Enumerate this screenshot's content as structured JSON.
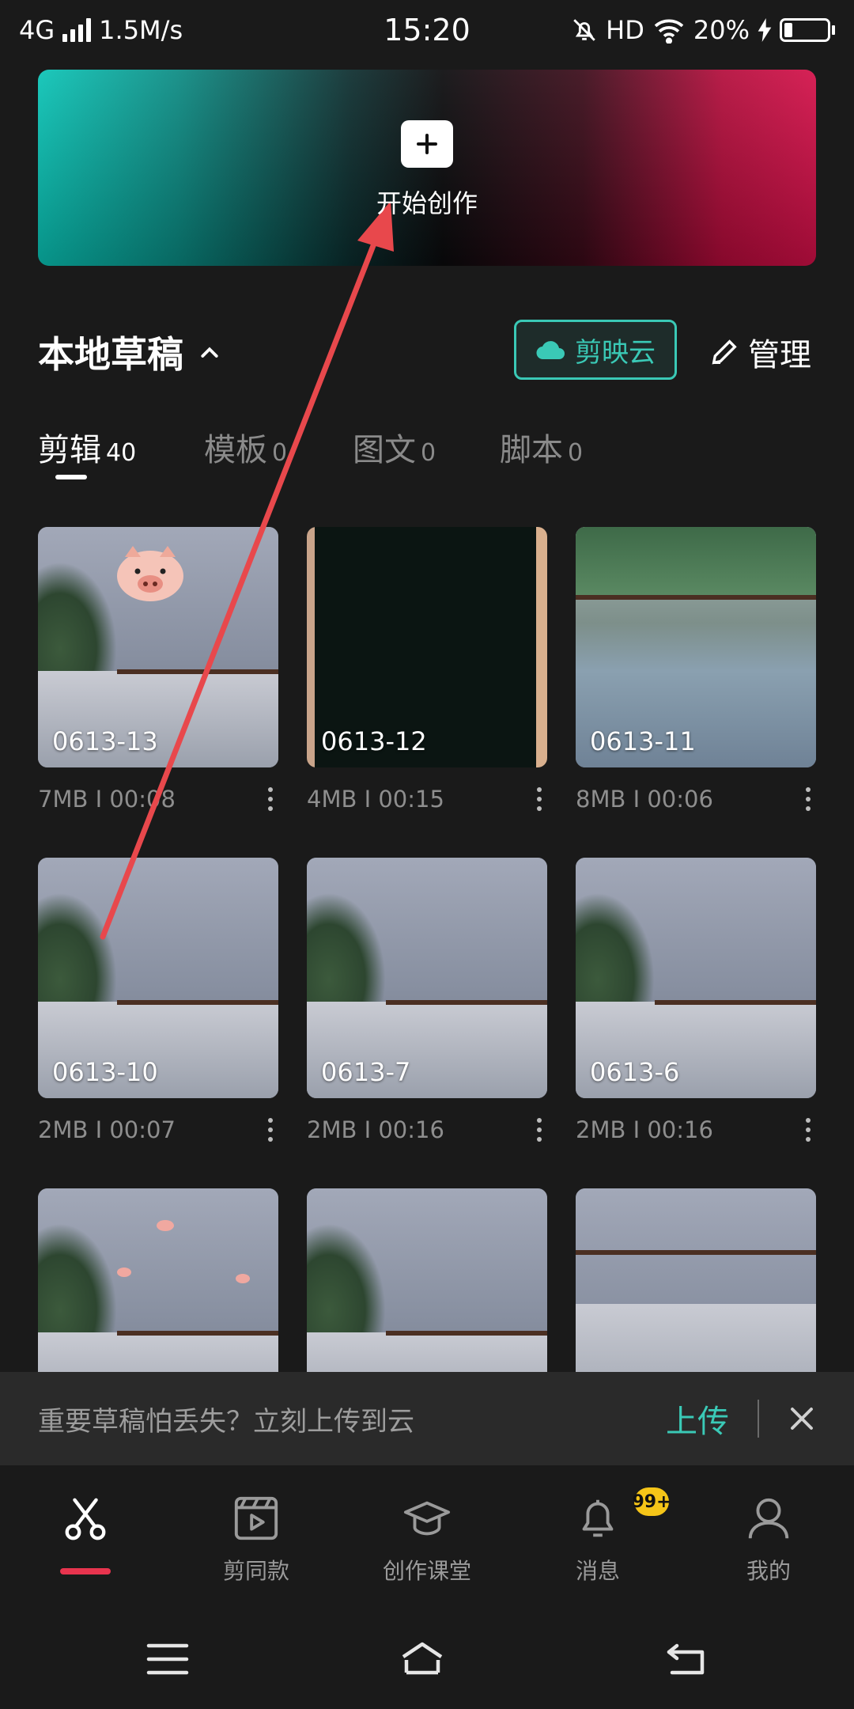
{
  "status_bar": {
    "network": "4G",
    "speed": "1.5M/s",
    "time": "15:20",
    "hd": "HD",
    "battery": "20%",
    "battery_level": 0.2
  },
  "hero": {
    "label": "开始创作"
  },
  "drafts": {
    "title": "本地草稿",
    "cloud_label": "剪映云",
    "manage_label": "管理"
  },
  "tabs": [
    {
      "label": "剪辑",
      "count": "40"
    },
    {
      "label": "模板",
      "count": "0"
    },
    {
      "label": "图文",
      "count": "0"
    },
    {
      "label": "脚本",
      "count": "0"
    }
  ],
  "cards": [
    {
      "name": "0613-13",
      "meta": "7MB Ⅰ 00:08"
    },
    {
      "name": "0613-12",
      "meta": "4MB Ⅰ 00:15"
    },
    {
      "name": "0613-11",
      "meta": "8MB Ⅰ 00:06"
    },
    {
      "name": "0613-10",
      "meta": "2MB Ⅰ 00:07"
    },
    {
      "name": "0613-7",
      "meta": "2MB Ⅰ 00:16"
    },
    {
      "name": "0613-6",
      "meta": "2MB Ⅰ 00:16"
    }
  ],
  "upload_banner": {
    "message": "重要草稿怕丢失？立刻上传到云",
    "action": "上传"
  },
  "bottom_nav": [
    {
      "label": "",
      "icon": "scissors-icon"
    },
    {
      "label": "剪同款",
      "icon": "video-template-icon"
    },
    {
      "label": "创作课堂",
      "icon": "graduation-cap-icon"
    },
    {
      "label": "消息",
      "icon": "bell-icon"
    },
    {
      "label": "我的",
      "icon": "user-icon"
    }
  ],
  "badge": "99+",
  "colors": {
    "accent": "#3ac9b6",
    "active_indicator": "#e8344e",
    "badge": "#f5c518",
    "annotation_arrow": "#e8484c"
  }
}
